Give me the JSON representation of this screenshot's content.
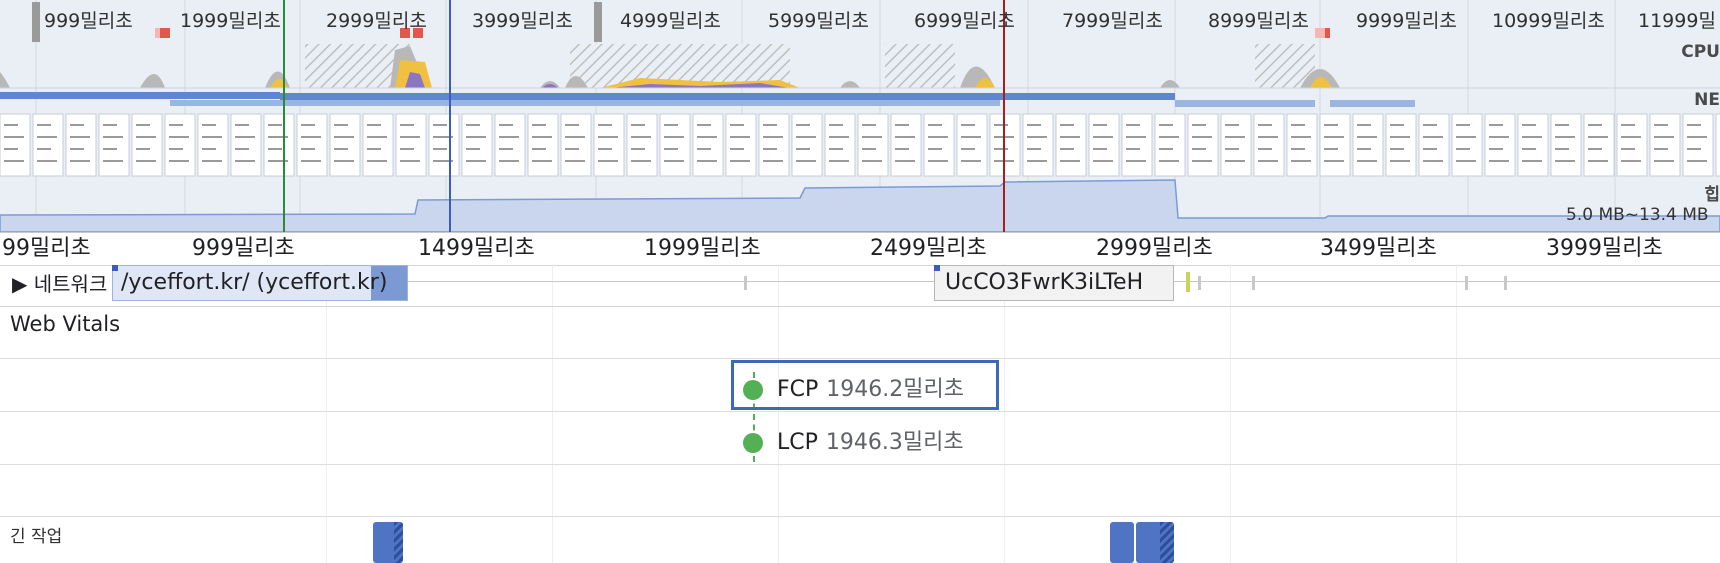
{
  "overview": {
    "ticks": [
      "999밀리초",
      "1999밀리초",
      "2999밀리초",
      "3999밀리초",
      "4999밀리초",
      "5999밀리초",
      "6999밀리초",
      "7999밀리초",
      "8999밀리초",
      "9999밀리초",
      "10999밀리초",
      "11999밀"
    ],
    "track_labels": {
      "cpu": "CPU",
      "net": "NE",
      "heap": "힙"
    },
    "memory_range": "5.0 MB~13.4 MB"
  },
  "ruler": {
    "ticks": [
      "99밀리초",
      "999밀리초",
      "1499밀리초",
      "1999밀리초",
      "2499밀리초",
      "2999밀리초",
      "3499밀리초",
      "3999밀리초"
    ]
  },
  "network": {
    "label": "▶ 네트워크",
    "requests": [
      {
        "label": "/yceffort.kr/ (yceffort.kr)"
      },
      {
        "label": "UcCO3FwrK3iLTeH"
      }
    ]
  },
  "web_vitals": {
    "title": "Web Vitals",
    "fcp": {
      "name": "FCP",
      "value": "1946.2밀리초"
    },
    "lcp": {
      "name": "LCP",
      "value": "1946.3밀리초"
    }
  },
  "long_tasks": {
    "label": "긴 작업"
  },
  "colors": {
    "overview_bg": "#eaeef5",
    "cpu_scripting": "#f0c040",
    "cpu_rendering": "#8a76c2",
    "cpu_other": "#b8b8b8",
    "network_bar": "#5f87cf",
    "selection_start": "#2a8a3a",
    "selection_end": "#3a5bbf",
    "cursor": "#a32020",
    "vital_dot": "#54b055",
    "long_task": "#4f74c4"
  }
}
